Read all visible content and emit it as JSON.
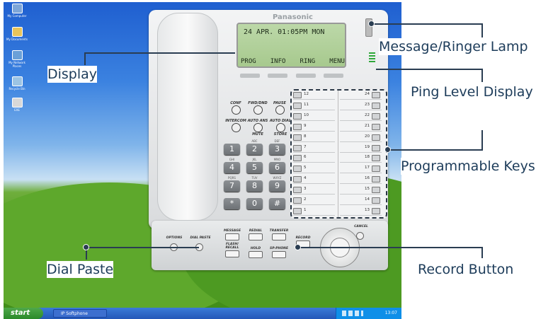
{
  "desktop": {
    "icons": [
      {
        "name": "my-computer-icon",
        "label": "My Computer"
      },
      {
        "name": "my-documents-icon",
        "label": "My Documents"
      },
      {
        "name": "my-network-places-icon",
        "label": "My Network Places"
      },
      {
        "name": "recycle-bin-icon",
        "label": "Recycle Bin"
      },
      {
        "name": "shortcut-icon",
        "label": "EXE"
      }
    ]
  },
  "taskbar": {
    "start_label": "start",
    "task_item_label": "IP Softphone",
    "clock": "13:07"
  },
  "phone": {
    "brand": "Panasonic",
    "lcd": {
      "line1": "24 APR. 01:05PM  MON",
      "soft_labels": [
        "PROG",
        "INFO",
        "RING",
        "MENU"
      ]
    },
    "feature_keys": [
      {
        "top": "CONF",
        "bottom": ""
      },
      {
        "top": "FWD/DND",
        "bottom": ""
      },
      {
        "top": "PAUSE",
        "bottom": ""
      },
      {
        "top": "INTERCOM",
        "bottom": ""
      },
      {
        "top": "AUTO ANS",
        "bottom": "MUTE"
      },
      {
        "top": "AUTO DIAL",
        "bottom": "STORE"
      }
    ],
    "dialpad": [
      {
        "digit": "1",
        "sub": ""
      },
      {
        "digit": "2",
        "sub": "ABC"
      },
      {
        "digit": "3",
        "sub": "DEF"
      },
      {
        "digit": "4",
        "sub": "GHI"
      },
      {
        "digit": "5",
        "sub": "JKL"
      },
      {
        "digit": "6",
        "sub": "MNO"
      },
      {
        "digit": "7",
        "sub": "PQRS"
      },
      {
        "digit": "8",
        "sub": "TUV"
      },
      {
        "digit": "9",
        "sub": "WXYZ"
      },
      {
        "digit": "*",
        "sub": ""
      },
      {
        "digit": "0",
        "sub": ""
      },
      {
        "digit": "#",
        "sub": ""
      }
    ],
    "programmable_keys_left": [
      "12",
      "11",
      "10",
      "9",
      "8",
      "7",
      "6",
      "5",
      "4",
      "3",
      "2",
      "1"
    ],
    "programmable_keys_right": [
      "24",
      "23",
      "22",
      "21",
      "20",
      "19",
      "18",
      "17",
      "16",
      "15",
      "14",
      "13"
    ],
    "bottom_keys": {
      "options": "OPTIONS",
      "dial_paste": "DIAL PASTE",
      "message": "MESSAGE",
      "redial": "REDIAL",
      "transfer": "TRANSFER",
      "flash_recall": "FLASH/ RECALL",
      "hold": "HOLD",
      "sp_phone": "SP-PHONE",
      "record": "RECORD",
      "cancel": "CANCEL"
    }
  },
  "callouts": {
    "display": "Display",
    "dial_paste": "Dial Paste",
    "message_ringer_lamp": "Message/Ringer Lamp",
    "ping_level_display": "Ping Level Display",
    "programmable_keys": "Programmable Keys",
    "record_button": "Record Button"
  },
  "colors": {
    "callout_text": "#1d3c5a",
    "lcd_background": "#b4d39c",
    "ping_level_bars": "#2fa83a"
  }
}
